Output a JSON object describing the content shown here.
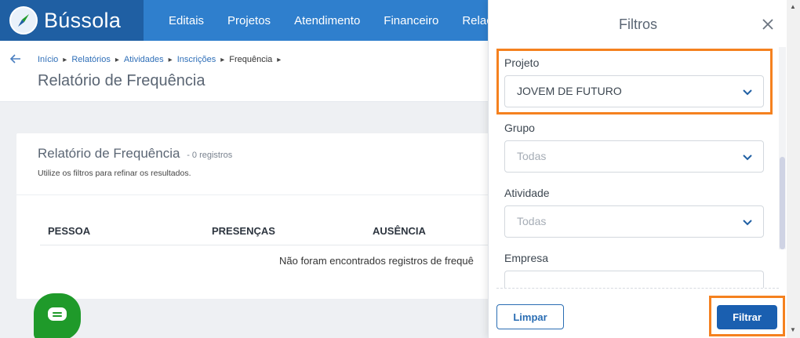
{
  "brand": {
    "name": "Bússola"
  },
  "nav": {
    "items": [
      "Editais",
      "Projetos",
      "Atendimento",
      "Financeiro",
      "Relac"
    ]
  },
  "breadcrumb": {
    "items": [
      "Início",
      "Relatórios",
      "Atividades",
      "Inscrições"
    ],
    "current": "Frequência"
  },
  "page": {
    "title": "Relatório de Frequência"
  },
  "card": {
    "title": "Relatório de Frequência",
    "count": "- 0 registros",
    "subtitle": "Utilize os filtros para refinar os resultados.",
    "columns": [
      "PESSOA",
      "PRESENÇAS",
      "AUSÊNCIA"
    ],
    "empty_message": "Não foram encontrados registros de frequê"
  },
  "filters": {
    "title": "Filtros",
    "fields": [
      {
        "label": "Projeto",
        "value": "JOVEM DE FUTURO"
      },
      {
        "label": "Grupo",
        "value": "Todas"
      },
      {
        "label": "Atividade",
        "value": "Todas"
      },
      {
        "label": "Empresa",
        "value": ""
      }
    ],
    "clear_label": "Limpar",
    "filter_label": "Filtrar"
  },
  "colors": {
    "topbar": "#2f7fcd",
    "brand_bg": "#1f5fa3",
    "highlight": "#f5811f",
    "primary_button": "#1a5fb0",
    "chat_button": "#1f9a2a"
  }
}
